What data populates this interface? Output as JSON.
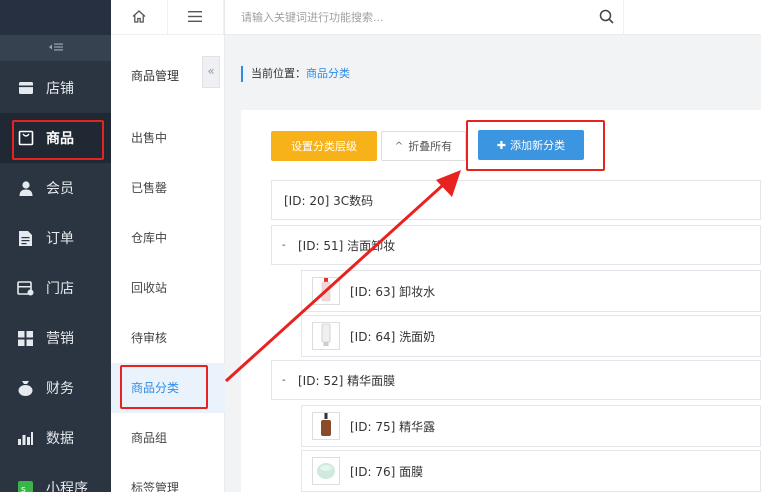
{
  "sidebar": {
    "collapse_icon": "collapse-menu-icon",
    "items": [
      {
        "label": "店铺",
        "icon": "store-icon"
      },
      {
        "label": "商品",
        "icon": "bag-icon"
      },
      {
        "label": "会员",
        "icon": "user-icon"
      },
      {
        "label": "订单",
        "icon": "document-icon"
      },
      {
        "label": "门店",
        "icon": "shop-icon"
      },
      {
        "label": "营销",
        "icon": "grid-icon"
      },
      {
        "label": "财务",
        "icon": "moneybag-icon"
      },
      {
        "label": "数据",
        "icon": "bar-chart-icon"
      },
      {
        "label": "小程序",
        "icon": "miniprogram-icon"
      }
    ],
    "active_index": 1
  },
  "subnav": {
    "title": "商品管理",
    "fold_label": "«",
    "items": [
      "出售中",
      "已售罄",
      "仓库中",
      "回收站",
      "待审核",
      "商品分类",
      "商品组",
      "标签管理"
    ],
    "active_index": 5
  },
  "topbar": {
    "search_placeholder": "请输入关键词进行功能搜索..."
  },
  "breadcrumb": {
    "prefix": "当前位置：",
    "current": "商品分类"
  },
  "toolbar": {
    "set_level_label": "设置分类层级",
    "collapse_all_label": "折叠所有",
    "collapse_all_prefix": "^",
    "add_label": "添加新分类",
    "add_prefix": "✚"
  },
  "categories": [
    {
      "label": "[ID: 20] 3C数码"
    },
    {
      "label": "[ID: 51] 洁面卸妆",
      "toggle": "-"
    },
    {
      "label": "[ID: 63] 卸妆水"
    },
    {
      "label": "[ID: 64] 洗面奶"
    },
    {
      "label": "[ID: 52] 精华面膜",
      "toggle": "-"
    },
    {
      "label": "[ID: 75] 精华露"
    },
    {
      "label": "[ID: 76] 面膜"
    }
  ],
  "colors": {
    "accent": "#2d8ce8",
    "highlight": "#e8231f",
    "sidebar_bg": "#2b3542",
    "yellow_button": "#f7b21a",
    "blue_button": "#3b95e0"
  }
}
